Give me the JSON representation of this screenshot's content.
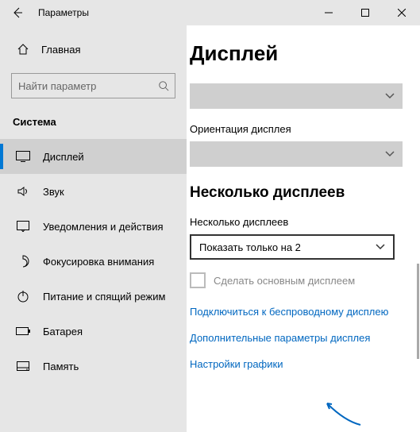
{
  "window": {
    "title": "Параметры"
  },
  "sidebar": {
    "home": "Главная",
    "search_placeholder": "Найти параметр",
    "category": "Система",
    "items": [
      {
        "label": "Дисплей"
      },
      {
        "label": "Звук"
      },
      {
        "label": "Уведомления и действия"
      },
      {
        "label": "Фокусировка внимания"
      },
      {
        "label": "Питание и спящий режим"
      },
      {
        "label": "Батарея"
      },
      {
        "label": "Память"
      }
    ]
  },
  "content": {
    "title": "Дисплей",
    "orientation_label": "Ориентация дисплея",
    "multi_title": "Несколько дисплеев",
    "multi_label": "Несколько дисплеев",
    "multi_value": "Показать только на 2",
    "make_main": "Сделать основным дисплеем",
    "links": {
      "wireless": "Подключиться к беспроводному дисплею",
      "advanced": "Дополнительные параметры дисплея",
      "graphics": "Настройки графики"
    }
  }
}
